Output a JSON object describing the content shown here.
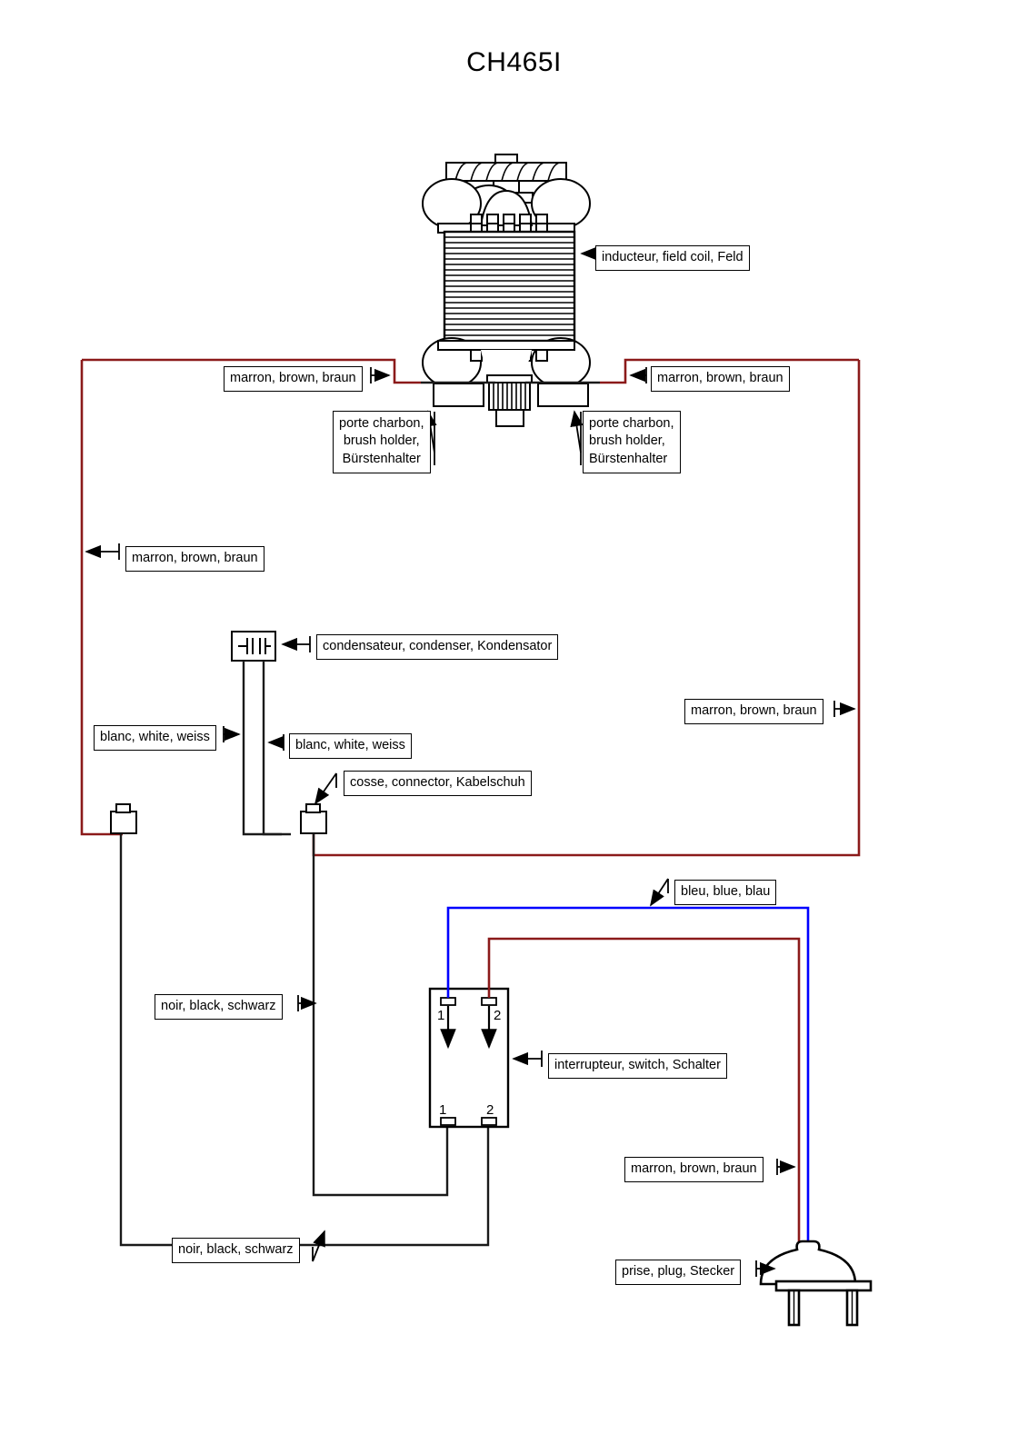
{
  "document": {
    "title": "CH465I",
    "type": "wiring-diagram"
  },
  "colors": {
    "wire_brown": "#8b1a1a",
    "wire_blue": "#0000ff",
    "wire_black": "#1a1a1a",
    "outline": "#000000",
    "background": "#ffffff"
  },
  "labels": {
    "field_coil": "inducteur, field coil, Feld",
    "brown_left_motor": "marron, brown, braun",
    "brown_right_motor": "marron, brown, braun",
    "brush_holder_left": "porte charbon,\nbrush holder,\nBürstenhalter",
    "brush_holder_right": "porte charbon,\nbrush holder,\nBürstenhalter",
    "brown_left_loop": "marron, brown, braun",
    "capacitor": "condensateur, condenser, Kondensator",
    "white_left": "blanc, white, weiss",
    "white_right": "blanc, white, weiss",
    "connector": "cosse, connector, Kabelschuh",
    "brown_right_loop": "marron, brown, braun",
    "blue_cord": "bleu, blue, blau",
    "black_switch": "noir, black, schwarz",
    "switch": "interrupteur, switch, Schalter",
    "brown_cord": "marron, brown, braun",
    "black_bottom": "noir, black, schwarz",
    "plug": "prise, plug, Stecker"
  },
  "switch": {
    "terminals_top": [
      "1",
      "2"
    ],
    "terminals_bottom": [
      "1",
      "2"
    ]
  },
  "components": [
    {
      "name": "field-coil",
      "label": "inducteur, field coil, Feld"
    },
    {
      "name": "brush-holder",
      "label": "porte charbon, brush holder, Bürstenhalter"
    },
    {
      "name": "capacitor",
      "label": "condensateur, condenser, Kondensator"
    },
    {
      "name": "connector",
      "label": "cosse, connector, Kabelschuh"
    },
    {
      "name": "switch",
      "label": "interrupteur, switch, Schalter"
    },
    {
      "name": "plug",
      "label": "prise, plug, Stecker"
    }
  ],
  "wires": [
    {
      "name": "brown",
      "label": "marron, brown, braun",
      "color": "#8b1a1a"
    },
    {
      "name": "white",
      "label": "blanc, white, weiss",
      "color": "#1a1a1a"
    },
    {
      "name": "black",
      "label": "noir, black, schwarz",
      "color": "#1a1a1a"
    },
    {
      "name": "blue",
      "label": "bleu, blue, blau",
      "color": "#0000ff"
    }
  ]
}
